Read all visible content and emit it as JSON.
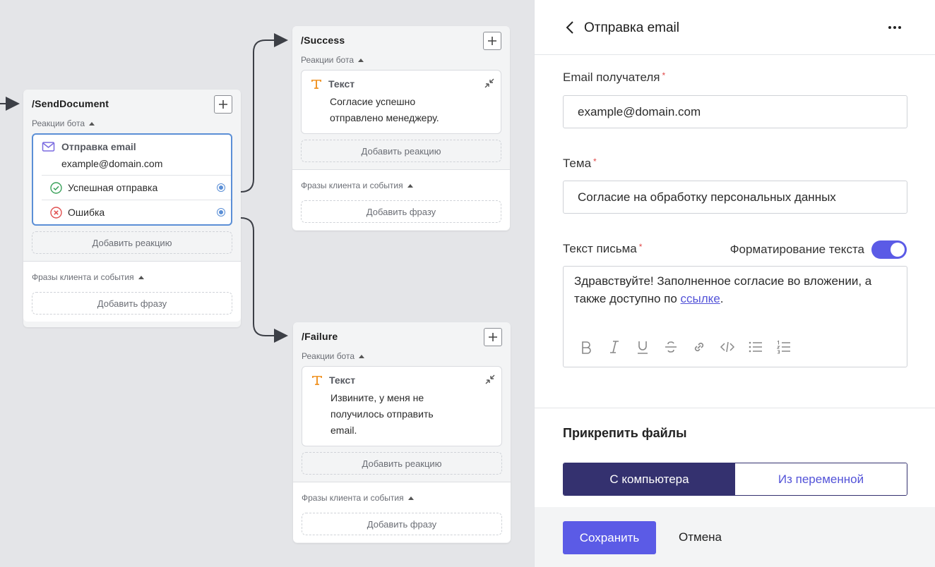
{
  "canvas": {
    "send_document": {
      "title": "/SendDocument",
      "bot_reactions_label": "Реакции бота",
      "email_card": {
        "title": "Отправка email",
        "address": "example@domain.com",
        "success_label": "Успешная отправка",
        "error_label": "Ошибка"
      },
      "add_reaction_label": "Добавить реакцию",
      "phrases_label": "Фразы клиента и события",
      "add_phrase_label": "Добавить фразу"
    },
    "success": {
      "title": "/Success",
      "bot_reactions_label": "Реакции бота",
      "text_card_title": "Текст",
      "text_card_line1": "Согласие успешно",
      "text_card_line2": "отправлено менеджеру.",
      "add_reaction_label": "Добавить реакцию",
      "phrases_label": "Фразы клиента и события",
      "add_phrase_label": "Добавить фразу"
    },
    "failure": {
      "title": "/Failure",
      "bot_reactions_label": "Реакции бота",
      "text_card_title": "Текст",
      "text_card_line1": "Извините, у меня не",
      "text_card_line2": "получилось отправить",
      "text_card_line3": "email.",
      "add_reaction_label": "Добавить реакцию",
      "phrases_label": "Фразы клиента и события",
      "add_phrase_label": "Добавить фразу"
    }
  },
  "panel": {
    "title": "Отправка email",
    "recipient": {
      "label": "Email получателя",
      "required_mark": "*",
      "value": "example@domain.com"
    },
    "subject": {
      "label": "Тема",
      "required_mark": "*",
      "value": "Согласие на обработку персональных данных"
    },
    "body": {
      "label": "Текст письма",
      "required_mark": "*",
      "formatting_label": "Форматирование текста",
      "formatting_enabled": true,
      "text_before_link": "Здравствуйте! Заполненное согласие во вложении, а также доступно по ",
      "link_text": "ссылке",
      "text_after_link": "."
    },
    "attach": {
      "title": "Прикрепить файлы",
      "from_computer": "С компьютера",
      "from_variable": "Из переменной"
    },
    "footer": {
      "save_label": "Сохранить",
      "cancel_label": "Отмена"
    }
  },
  "colors": {
    "accent": "#5b5be6",
    "segment_active": "#34316f",
    "selected_border": "#5b8fd6",
    "text_icon": "#f0962a",
    "success": "#3aa15a",
    "error": "#e05050"
  }
}
